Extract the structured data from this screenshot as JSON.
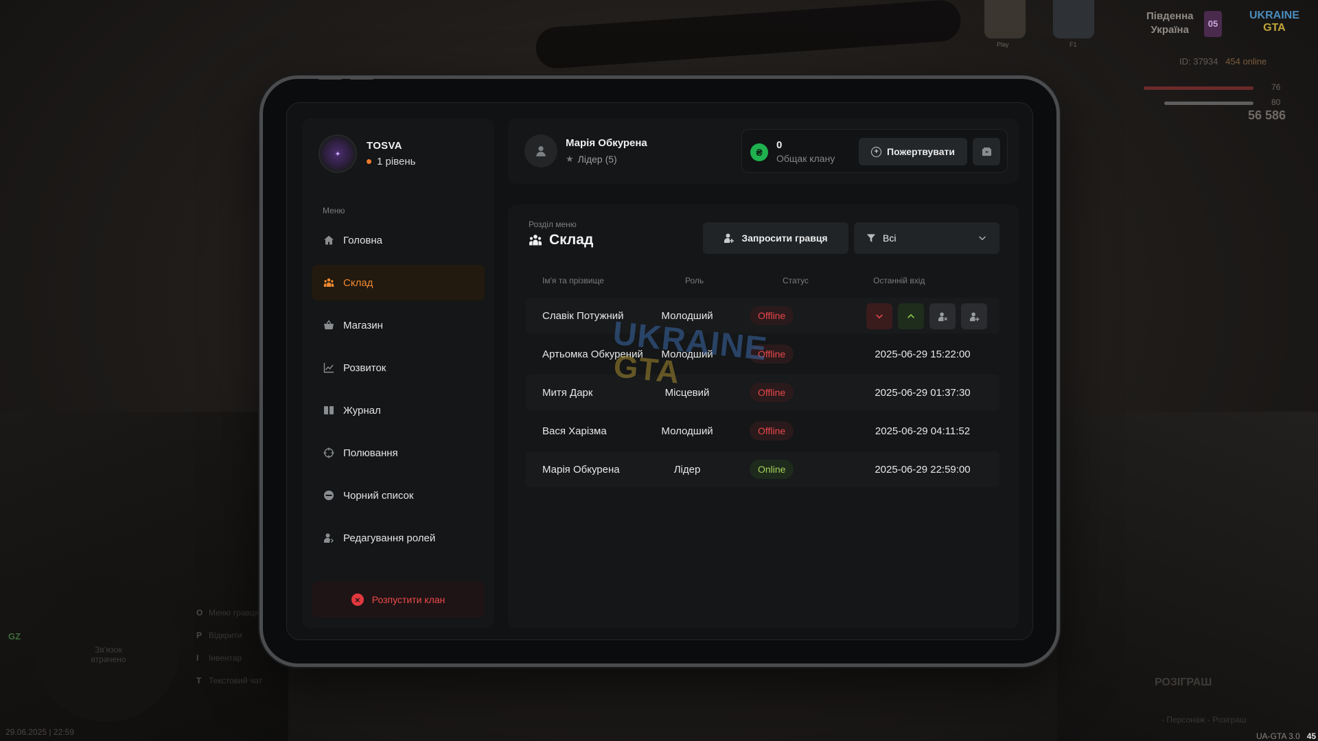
{
  "hud": {
    "region_line1": "Південна",
    "region_line2": "Україна",
    "region_badge": "05",
    "logo_top": "UKRAINE",
    "logo_bottom": "GTA",
    "player_id": "ID: 37934",
    "online": "454 online",
    "health": "76",
    "armor": "80",
    "money": "56 586",
    "car1_label": "Play",
    "car2_label": "F1",
    "map_lost": "Зв'язок втрачено",
    "gz": "GZ",
    "hints": [
      {
        "key": "O",
        "label": "Меню гравця"
      },
      {
        "key": "P",
        "label": "Відкрити"
      },
      {
        "key": "I",
        "label": "Інвентар"
      },
      {
        "key": "T",
        "label": "Текстовий чат"
      }
    ],
    "datetime": "29.06.2025 | 22:59",
    "giveaway_title": "РОЗІГРАШ",
    "giveaway_sub": "- Персонаж - Розіграш",
    "version": "UA-GTA 3.0",
    "fps": "45"
  },
  "sidebar": {
    "clan_name": "TOSVA",
    "clan_level": "1 рівень",
    "menu_caption": "Меню",
    "items": [
      {
        "label": "Головна",
        "icon": "home-icon",
        "active": false
      },
      {
        "label": "Склад",
        "icon": "group-icon",
        "active": true
      },
      {
        "label": "Магазин",
        "icon": "basket-icon",
        "active": false
      },
      {
        "label": "Розвиток",
        "icon": "chart-icon",
        "active": false
      },
      {
        "label": "Журнал",
        "icon": "book-icon",
        "active": false
      },
      {
        "label": "Полювання",
        "icon": "crosshair-icon",
        "active": false
      },
      {
        "label": "Чорний список",
        "icon": "blocked-icon",
        "active": false
      },
      {
        "label": "Редагування ролей",
        "icon": "user-edit-icon",
        "active": false
      }
    ],
    "disband_label": "Розпустити клан"
  },
  "header": {
    "user_name": "Марія Обкурена",
    "user_role": "Лідер (5)",
    "bank_value": "0",
    "bank_label": "Общак клану",
    "donate_label": "Пожертвувати"
  },
  "panel": {
    "section_caption": "Розділ меню",
    "section_title": "Склад",
    "invite_label": "Запросити гравця",
    "filter_value": "Всі",
    "columns": {
      "name": "Ім'я та прізвище",
      "role": "Роль",
      "status": "Статус",
      "last": "Останній вхід"
    },
    "members": [
      {
        "name": "Славік Потужний",
        "role": "Молодший",
        "status": "Offline",
        "last": ""
      },
      {
        "name": "Артьомка Обкурений",
        "role": "Молодший",
        "status": "Offline",
        "last": "2025-06-29 15:22:00"
      },
      {
        "name": "Митя Дарк",
        "role": "Місцевий",
        "status": "Offline",
        "last": "2025-06-29 01:37:30"
      },
      {
        "name": "Вася Харізма",
        "role": "Молодший",
        "status": "Offline",
        "last": "2025-06-29 04:11:52"
      },
      {
        "name": "Марія Обкурена",
        "role": "Лідер",
        "status": "Online",
        "last": "2025-06-29 22:59:00"
      }
    ]
  },
  "watermark": {
    "top": "UKRAINE",
    "bottom": "GTA"
  },
  "colors": {
    "accent": "#f08a32",
    "offline": "#e9474c",
    "online": "#a7d35a",
    "danger": "#e2383f",
    "coin": "#1fb24f"
  }
}
